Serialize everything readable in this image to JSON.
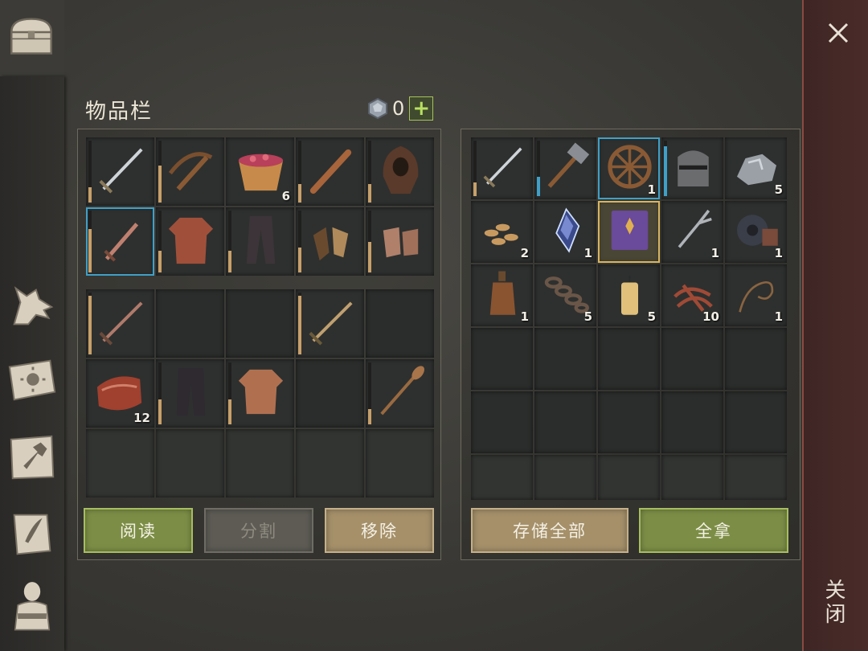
{
  "title": "物品栏",
  "currency": {
    "count": "0",
    "add_label": "+"
  },
  "buttons": {
    "read": "阅读",
    "split": "分割",
    "remove": "移除",
    "store_all": "存储全部",
    "take_all": "全拿"
  },
  "close_label": "关闭",
  "inventory": {
    "equip_row1": [
      {
        "icon": "longsword-icon",
        "dur": 0.25
      },
      {
        "icon": "crossbow-icon",
        "dur": 0.6
      },
      {
        "icon": "berry-bowl-icon",
        "qty": "6"
      },
      {
        "icon": "club-icon",
        "dur": 0.3
      },
      {
        "icon": "hood-icon",
        "dur": 0.3
      }
    ],
    "equip_row2": [
      {
        "icon": "dagger-icon",
        "dur": 0.7,
        "selected": true
      },
      {
        "icon": "chainmail-shirt-icon",
        "dur": 0.35
      },
      {
        "icon": "leather-pants-icon",
        "dur": 0.35
      },
      {
        "icon": "leather-gloves-icon",
        "dur": 0.4
      },
      {
        "icon": "chain-gloves-icon",
        "dur": 0.5
      }
    ],
    "bag_row1": [
      {
        "icon": "copper-sword-icon",
        "dur": 0.95
      },
      {},
      {},
      {
        "icon": "bronze-sword-icon",
        "dur": 0.95
      },
      {}
    ],
    "bag_row2": [
      {
        "icon": "raw-meat-icon",
        "qty": "12"
      },
      {
        "icon": "dark-pants-icon",
        "dur": 0.4
      },
      {
        "icon": "padded-tunic-icon",
        "dur": 0.4
      },
      {},
      {
        "icon": "paddle-icon",
        "dur": 0.25
      }
    ]
  },
  "storage": {
    "rows": [
      [
        {
          "icon": "longsword-icon",
          "dur": 0.25
        },
        {
          "icon": "sledgehammer-icon",
          "dur": 0.35,
          "blue": true
        },
        {
          "icon": "wagon-wheel-icon",
          "qty": "1",
          "selected": true
        },
        {
          "icon": "knight-helmet-icon",
          "dur": 0.9,
          "blue": true
        },
        {
          "icon": "stone-ore-icon",
          "qty": "5"
        }
      ],
      [
        {
          "icon": "seeds-icon",
          "qty": "2"
        },
        {
          "icon": "crystal-icon",
          "qty": "1"
        },
        {
          "icon": "spellbook-icon",
          "gold": true
        },
        {
          "icon": "fork-blade-icon",
          "qty": "1"
        },
        {
          "icon": "gear-parts-icon",
          "qty": "1"
        }
      ],
      [
        {
          "icon": "bottle-icon",
          "qty": "1"
        },
        {
          "icon": "chain-icon",
          "qty": "5"
        },
        {
          "icon": "candle-icon",
          "qty": "5"
        },
        {
          "icon": "scrap-pile-icon",
          "qty": "10"
        },
        {
          "icon": "rope-icon",
          "qty": "1"
        }
      ]
    ]
  },
  "colors": {
    "dur_tan": "#c8a06a",
    "dur_blue": "#3fa0c8",
    "accent_green": "#a6c25a"
  }
}
